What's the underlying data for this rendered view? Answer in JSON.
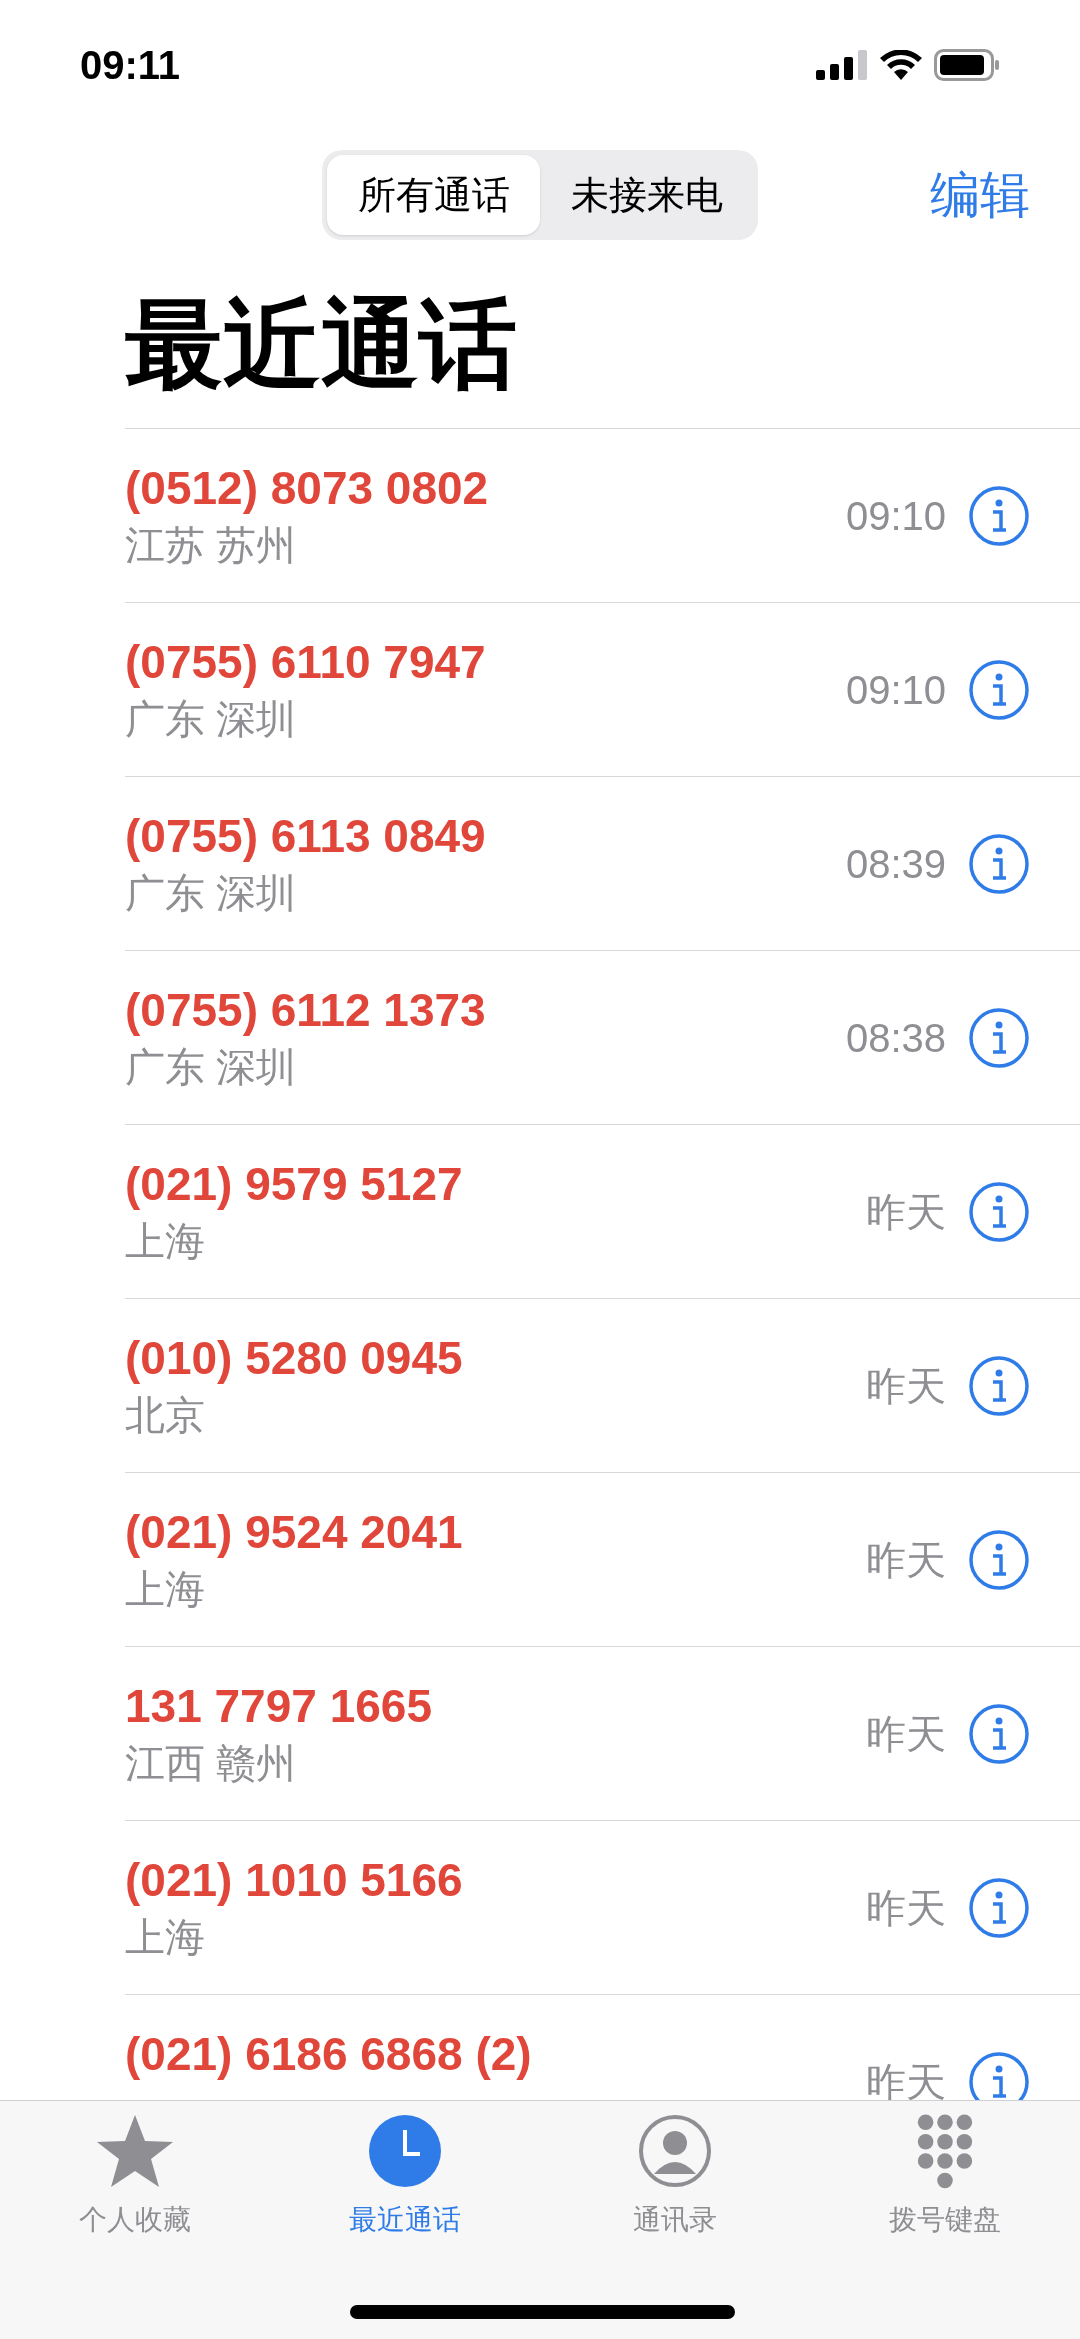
{
  "status_bar": {
    "time": "09:11"
  },
  "segments": [
    {
      "label": "所有通话",
      "selected": true
    },
    {
      "label": "未接来电",
      "selected": false
    }
  ],
  "edit_button": "编辑",
  "title": "最近通话",
  "calls": [
    {
      "number": "(0512) 8073 0802",
      "location": "江苏 苏州",
      "time": "09:10",
      "missed": true
    },
    {
      "number": "(0755) 6110 7947",
      "location": "广东 深圳",
      "time": "09:10",
      "missed": true
    },
    {
      "number": "(0755) 6113 0849",
      "location": "广东 深圳",
      "time": "08:39",
      "missed": true
    },
    {
      "number": "(0755) 6112 1373",
      "location": "广东 深圳",
      "time": "08:38",
      "missed": true
    },
    {
      "number": "(021) 9579 5127",
      "location": "上海",
      "time": "昨天",
      "missed": true
    },
    {
      "number": "(010) 5280 0945",
      "location": "北京",
      "time": "昨天",
      "missed": true
    },
    {
      "number": "(021) 9524 2041",
      "location": "上海",
      "time": "昨天",
      "missed": true
    },
    {
      "number": "131 7797 1665",
      "location": "江西 赣州",
      "time": "昨天",
      "missed": true
    },
    {
      "number": "(021) 1010 5166",
      "location": "上海",
      "time": "昨天",
      "missed": true
    },
    {
      "number": "(021) 6186 6868 (2)",
      "time": "昨天",
      "missed": true
    }
  ],
  "tab_bar": [
    {
      "kind": "star",
      "label": "个人收藏",
      "selected": false
    },
    {
      "kind": "clock",
      "label": "最近通话",
      "selected": true
    },
    {
      "kind": "person",
      "label": "通讯录",
      "selected": false
    },
    {
      "kind": "keypad",
      "label": "拨号键盘",
      "selected": false
    }
  ]
}
